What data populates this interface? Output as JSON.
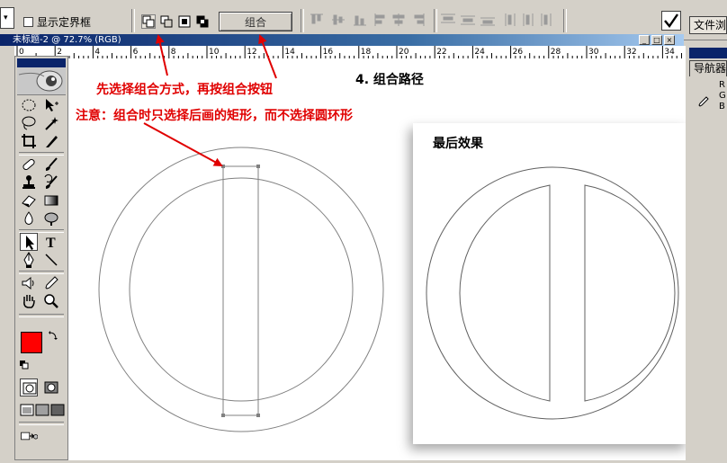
{
  "options_bar": {
    "preset_arrow": "▾",
    "show_bbox_label": "显示定界框",
    "show_bbox_checked": false,
    "combine_label": "组合",
    "file_browser_tab": "文件浏"
  },
  "document": {
    "title": "未标题-2 @ 72.7% (RGB)",
    "ruler_top": [
      "0",
      "2",
      "4",
      "6",
      "8",
      "10",
      "12",
      "14",
      "16",
      "18",
      "20",
      "22",
      "24",
      "26",
      "28",
      "30",
      "32",
      "34"
    ]
  },
  "tools": {
    "type_label": "T",
    "foreground_color": "#ff0000",
    "background_color": "#000000"
  },
  "panels": {
    "navigator_tab": "导航器",
    "rgb_labels": [
      "R",
      "G",
      "B"
    ]
  },
  "annotations": {
    "step_title": "4. 组合路径",
    "instruction": "先选择组合方式，再按组合按钮",
    "note": "注意：组合时只选择后画的矩形，而不选择圆环形",
    "result_title": "最后效果"
  },
  "colors": {
    "annotation_red": "#e00000",
    "arrow_red": "#e00000",
    "path_gray": "#808080"
  }
}
